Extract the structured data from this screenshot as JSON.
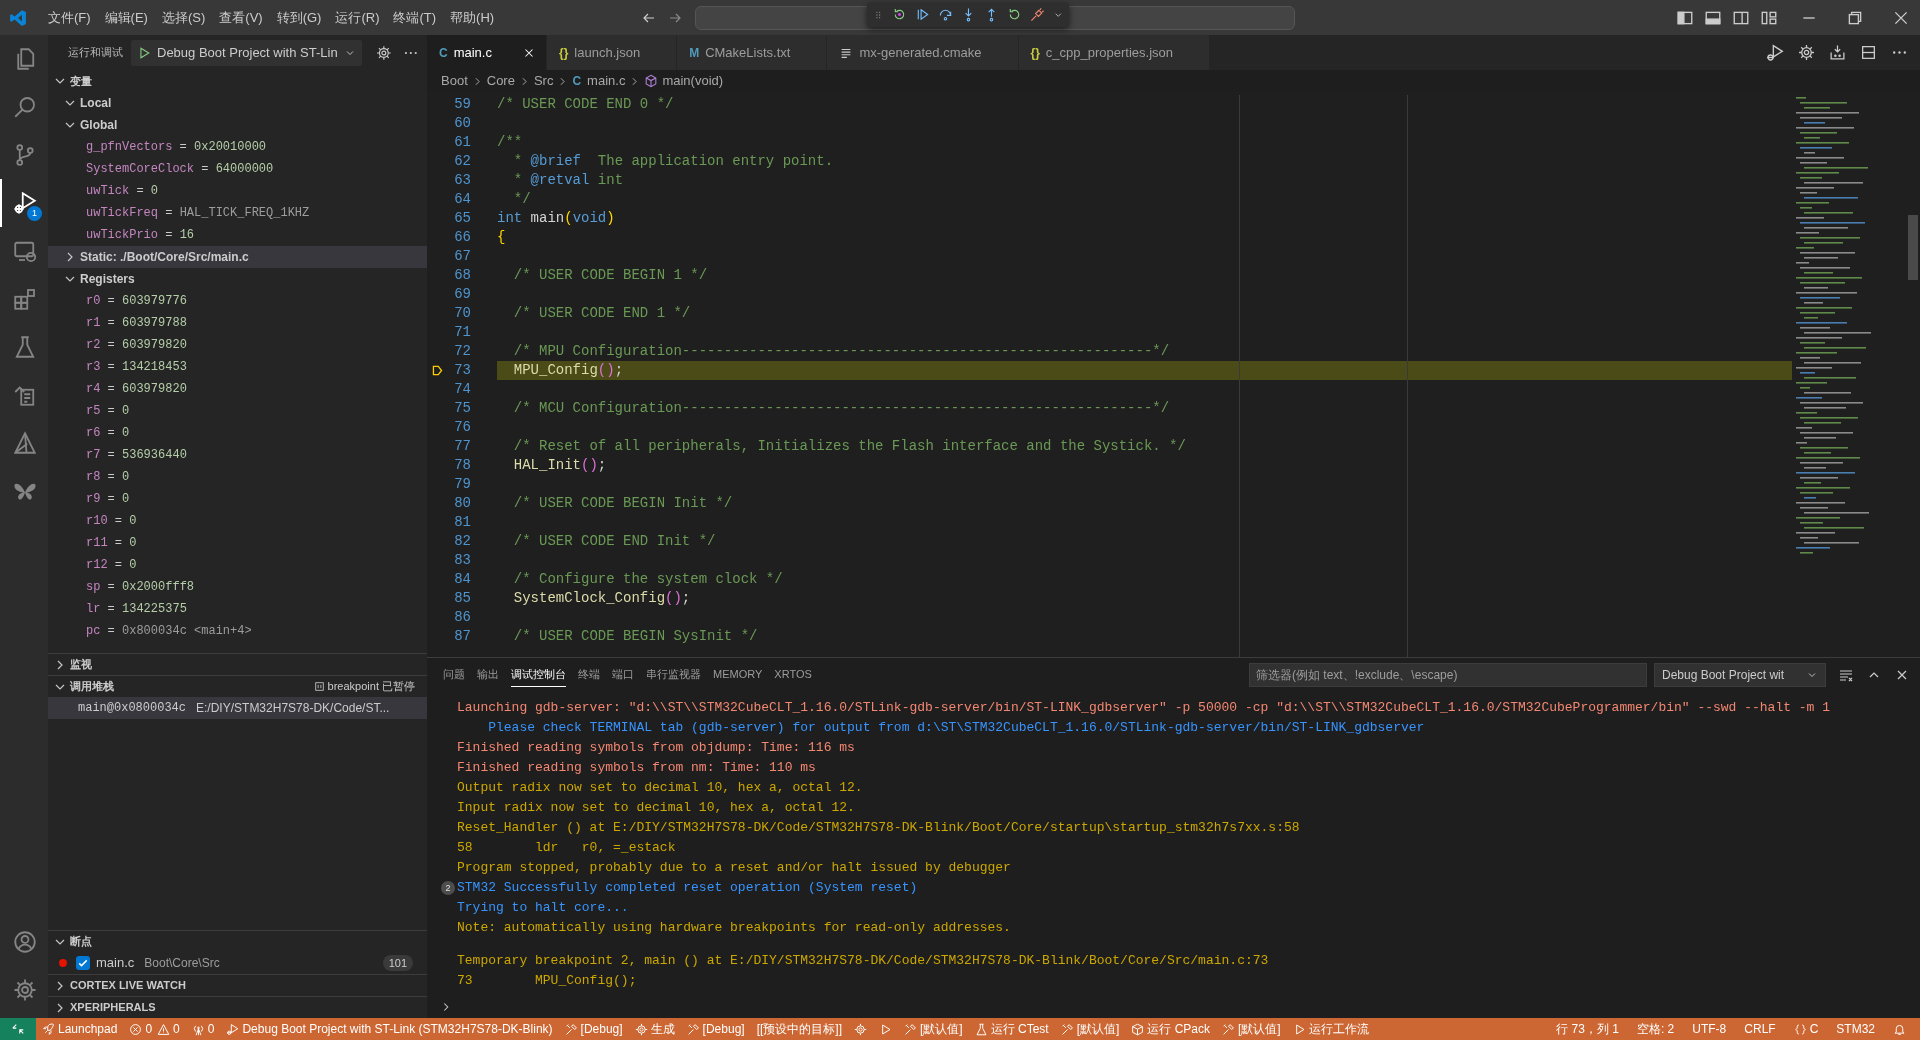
{
  "title_bar": {
    "menu": [
      "文件(F)",
      "编辑(E)",
      "选择(S)",
      "查看(V)",
      "转到(G)",
      "运行(R)",
      "终端(T)",
      "帮助(H)"
    ]
  },
  "debug_toolbar": {
    "buttons": [
      {
        "kind": "restart-frame"
      },
      {
        "kind": "continue"
      },
      {
        "kind": "step-over"
      },
      {
        "kind": "step-into"
      },
      {
        "kind": "step-out"
      },
      {
        "kind": "restart"
      },
      {
        "kind": "disconnect"
      }
    ]
  },
  "activity_bar": {
    "items": [
      {
        "kind": "files",
        "selected": false
      },
      {
        "kind": "search",
        "selected": false
      },
      {
        "kind": "branch",
        "selected": false
      },
      {
        "kind": "debug",
        "selected": true,
        "badge": "1"
      },
      {
        "kind": "remote",
        "selected": false
      },
      {
        "kind": "extensions",
        "selected": false
      },
      {
        "kind": "flask",
        "selected": false
      },
      {
        "kind": "document",
        "selected": false
      },
      {
        "kind": "cmake",
        "selected": false
      },
      {
        "kind": "stm32",
        "selected": false
      }
    ],
    "bottom": [
      {
        "kind": "account",
        "selected": false
      },
      {
        "kind": "gear",
        "selected": false
      }
    ]
  },
  "sidebar": {
    "title": "运行和调试",
    "config": "Debug Boot Project with ST-Lin",
    "sections": [
      {
        "kind": "variables",
        "title": "变量",
        "expanded": true,
        "children": [
          {
            "label": "Local",
            "expanded": true,
            "selected": false
          },
          {
            "label": "Global",
            "expanded": true,
            "selected": false,
            "children": [
              {
                "name": "g_pfnVectors",
                "sign": "=",
                "value": "0x20010000",
                "kind": "number"
              },
              {
                "name": "SystemCoreClock",
                "sign": "=",
                "value": "64000000",
                "kind": "number"
              },
              {
                "name": "uwTick",
                "sign": "=",
                "value": "0",
                "kind": "number"
              },
              {
                "name": "uwTickFreq",
                "sign": "=",
                "value": "HAL_TICK_FREQ_1KHZ",
                "kind": "symbol"
              },
              {
                "name": "uwTickPrio",
                "sign": "=",
                "value": "16",
                "kind": "number"
              }
            ]
          },
          {
            "label": "Static: ./Boot/Core/Src/main.c",
            "expanded": false,
            "selected": true
          },
          {
            "label": "Registers",
            "expanded": true,
            "selected": false,
            "children": [
              {
                "name": "r0",
                "sign": "=",
                "value": "603979776",
                "kind": "number"
              },
              {
                "name": "r1",
                "sign": "=",
                "value": "603979788",
                "kind": "number"
              },
              {
                "name": "r2",
                "sign": "=",
                "value": "603979820",
                "kind": "number"
              },
              {
                "name": "r3",
                "sign": "=",
                "value": "134218453",
                "kind": "number"
              },
              {
                "name": "r4",
                "sign": "=",
                "value": "603979820",
                "kind": "number"
              },
              {
                "name": "r5",
                "sign": "=",
                "value": "0",
                "kind": "number"
              },
              {
                "name": "r6",
                "sign": "=",
                "value": "0",
                "kind": "number"
              },
              {
                "name": "r7",
                "sign": "=",
                "value": "536936440",
                "kind": "number"
              },
              {
                "name": "r8",
                "sign": "=",
                "value": "0",
                "kind": "number"
              },
              {
                "name": "r9",
                "sign": "=",
                "value": "0",
                "kind": "number"
              },
              {
                "name": "r10",
                "sign": "=",
                "value": "0",
                "kind": "number"
              },
              {
                "name": "r11",
                "sign": "=",
                "value": "0",
                "kind": "number"
              },
              {
                "name": "r12",
                "sign": "=",
                "value": "0",
                "kind": "number"
              },
              {
                "name": "sp",
                "sign": "=",
                "value": "0x2000fff8",
                "kind": "number"
              },
              {
                "name": "lr",
                "sign": "=",
                "value": "134225375",
                "kind": "number"
              },
              {
                "name": "pc",
                "sign": "=",
                "value": "0x800034c <main+4>",
                "kind": "symbol"
              }
            ]
          }
        ]
      },
      {
        "kind": "generic",
        "title": "监视",
        "expanded": false
      },
      {
        "kind": "call_stack",
        "title": "调用堆栈",
        "expanded": true,
        "status": "breakpoint 已暂停",
        "frames": [
          {
            "function": "main@0x0800034c",
            "file": "E:/DIY/STM32H7S78-DK/Code/ST...",
            "selected": true
          }
        ]
      },
      {
        "kind": "breakpoints",
        "title": "断点",
        "expanded": true,
        "items": [
          {
            "file": "main.c",
            "path": "Boot\\Core\\Src",
            "line": "101",
            "checked": true
          }
        ]
      },
      {
        "kind": "generic",
        "title": "CORTEX LIVE WATCH",
        "expanded": false
      },
      {
        "kind": "generic",
        "title": "XPERIPHERALS",
        "expanded": false
      }
    ]
  },
  "editor": {
    "tabs": [
      {
        "label": "main.c",
        "kind": "c",
        "icon": "C",
        "selected": true
      },
      {
        "label": "launch.json",
        "kind": "json",
        "icon": "{}",
        "selected": false
      },
      {
        "label": "CMakeLists.txt",
        "kind": "cmake",
        "icon": "M",
        "selected": false
      },
      {
        "label": "mx-generated.cmake",
        "kind": "text",
        "selected": false
      },
      {
        "label": "c_cpp_properties.json",
        "kind": "json",
        "icon": "{}",
        "selected": false
      }
    ],
    "breadcrumb": [
      {
        "text": "Boot"
      },
      {
        "text": "Core"
      },
      {
        "text": "Src"
      },
      {
        "text": "main.c",
        "icon": "C"
      },
      {
        "text": "main(void)",
        "kind": "symbol"
      }
    ],
    "lines": [
      {
        "n": "59",
        "current": false,
        "parts": [
          {
            "t": "/* USER CODE END 0 */",
            "kind": "comment"
          }
        ]
      },
      {
        "n": "60",
        "current": false
      },
      {
        "n": "61",
        "current": false,
        "parts": [
          {
            "t": "/**",
            "kind": "comment"
          }
        ]
      },
      {
        "n": "62",
        "current": false,
        "parts": [
          {
            "t": "  * ",
            "kind": "comment"
          },
          {
            "t": "@brief",
            "kind": "doctag"
          },
          {
            "t": "  The application entry point.",
            "kind": "comment"
          }
        ]
      },
      {
        "n": "63",
        "current": false,
        "parts": [
          {
            "t": "  * ",
            "kind": "comment"
          },
          {
            "t": "@retval",
            "kind": "doctag"
          },
          {
            "t": " int",
            "kind": "comment"
          }
        ]
      },
      {
        "n": "64",
        "current": false,
        "parts": [
          {
            "t": "  */",
            "kind": "comment"
          }
        ]
      },
      {
        "n": "65",
        "current": false,
        "parts": [
          {
            "t": "int",
            "kind": "keyword"
          },
          {
            "t": " main",
            "kind": "plain"
          },
          {
            "t": "(",
            "kind": "bracket1"
          },
          {
            "t": "void",
            "kind": "keyword"
          },
          {
            "t": ")",
            "kind": "bracket1"
          }
        ]
      },
      {
        "n": "66",
        "current": false,
        "parts": [
          {
            "t": "{",
            "kind": "bracket1"
          }
        ]
      },
      {
        "n": "67",
        "current": false
      },
      {
        "n": "68",
        "current": false,
        "parts": [
          {
            "t": "  /* USER CODE BEGIN 1 */",
            "kind": "comment"
          }
        ]
      },
      {
        "n": "69",
        "current": false
      },
      {
        "n": "70",
        "current": false,
        "parts": [
          {
            "t": "  /* USER CODE END 1 */",
            "kind": "comment"
          }
        ]
      },
      {
        "n": "71",
        "current": false
      },
      {
        "n": "72",
        "current": false,
        "parts": [
          {
            "t": "  /* MPU Configuration--------------------------------------------------------*/",
            "kind": "comment"
          }
        ]
      },
      {
        "n": "73",
        "current": true,
        "parts": [
          {
            "t": "  MPU_Config",
            "kind": "function"
          },
          {
            "t": "()",
            "kind": "bracket2"
          },
          {
            "t": ";",
            "kind": "plain"
          }
        ]
      },
      {
        "n": "74",
        "current": false
      },
      {
        "n": "75",
        "current": false,
        "parts": [
          {
            "t": "  /* MCU Configuration--------------------------------------------------------*/",
            "kind": "comment"
          }
        ]
      },
      {
        "n": "76",
        "current": false
      },
      {
        "n": "77",
        "current": false,
        "parts": [
          {
            "t": "  /* Reset of all peripherals, Initializes the Flash interface and the Systick. */",
            "kind": "comment"
          }
        ]
      },
      {
        "n": "78",
        "current": false,
        "parts": [
          {
            "t": "  HAL_Init",
            "kind": "function"
          },
          {
            "t": "()",
            "kind": "bracket2"
          },
          {
            "t": ";",
            "kind": "plain"
          }
        ]
      },
      {
        "n": "79",
        "current": false
      },
      {
        "n": "80",
        "current": false,
        "parts": [
          {
            "t": "  /* USER CODE BEGIN Init */",
            "kind": "comment"
          }
        ]
      },
      {
        "n": "81",
        "current": false
      },
      {
        "n": "82",
        "current": false,
        "parts": [
          {
            "t": "  /* USER CODE END Init */",
            "kind": "comment"
          }
        ]
      },
      {
        "n": "83",
        "current": false
      },
      {
        "n": "84",
        "current": false,
        "parts": [
          {
            "t": "  /* Configure the system clock */",
            "kind": "comment"
          }
        ]
      },
      {
        "n": "85",
        "current": false,
        "parts": [
          {
            "t": "  SystemClock_Config",
            "kind": "function"
          },
          {
            "t": "()",
            "kind": "bracket2"
          },
          {
            "t": ";",
            "kind": "plain"
          }
        ]
      },
      {
        "n": "86",
        "current": false
      },
      {
        "n": "87",
        "current": false,
        "parts": [
          {
            "t": "  /* USER CODE BEGIN SysInit */",
            "kind": "comment"
          }
        ]
      }
    ]
  },
  "panel": {
    "tabs": [
      {
        "label": "问题",
        "selected": false
      },
      {
        "label": "输出",
        "selected": false
      },
      {
        "label": "调试控制台",
        "selected": true
      },
      {
        "label": "终端",
        "selected": false
      },
      {
        "label": "端口",
        "selected": false
      },
      {
        "label": "串行监视器",
        "selected": false
      },
      {
        "label": "MEMORY",
        "selected": false
      },
      {
        "label": "XRTOS",
        "selected": false
      }
    ],
    "filter": {
      "placeholder": "筛选器(例如 text、!exclude、\\escape)"
    },
    "session": "Debug Boot Project wit",
    "lines": [
      {
        "kind": "stderr",
        "text": "Launching gdb-server: \"d:\\\\ST\\\\STM32CubeCLT_1.16.0/STLink-gdb-server/bin/ST-LINK_gdbserver\" -p 50000 -cp \"d:\\\\ST\\\\STM32CubeCLT_1.16.0/STM32CubeProgrammer/bin\" --swd --halt -m 1"
      },
      {
        "kind": "console",
        "text": "    Please check TERMINAL tab (gdb-server) for output from d:\\ST\\STM32CubeCLT_1.16.0/STLink-gdb-server/bin/ST-LINK_gdbserver"
      },
      {
        "kind": "stderr",
        "text": "Finished reading symbols from objdump: Time: 116 ms"
      },
      {
        "kind": "stderr",
        "text": "Finished reading symbols from nm: Time: 110 ms"
      },
      {
        "kind": "stdout",
        "text": "Output radix now set to decimal 10, hex a, octal 12."
      },
      {
        "kind": "stdout",
        "text": "Input radix now set to decimal 10, hex a, octal 12."
      },
      {
        "kind": "stdout",
        "text": "Reset_Handler () at E:/DIY/STM32H7S78-DK/Code/STM32H7S78-DK-Blink/Boot/Core/startup\\startup_stm32h7s7xx.s:58"
      },
      {
        "kind": "stdout",
        "text": "58        ldr   r0, =_estack"
      },
      {
        "kind": "stdout",
        "text": "Program stopped, probably due to a reset and/or halt issued by debugger"
      },
      {
        "kind": "console",
        "count": "2",
        "text": "STM32 Successfully completed reset operation (System reset)"
      },
      {
        "kind": "console",
        "text": "Trying to halt core..."
      },
      {
        "kind": "stdout",
        "text": "Note: automatically using hardware breakpoints for read-only addresses."
      },
      {
        "kind": "stdout",
        "blank_before": true,
        "text": "Temporary breakpoint 2, main () at E:/DIY/STM32H7S78-DK/Code/STM32H7S78-DK-Blink/Boot/Core/Src/main.c:73"
      },
      {
        "kind": "stdout",
        "text": "73        MPU_Config();"
      }
    ]
  },
  "status_bar": {
    "left": [
      {
        "kind": "rocket",
        "text": "Launchpad"
      },
      {
        "kind": "problems",
        "errors": "0",
        "warnings": "0"
      },
      {
        "kind": "antenna",
        "text": "0"
      },
      {
        "kind": "debug",
        "text": "Debug Boot Project with ST-Link (STM32H7S78-DK-Blink)"
      },
      {
        "kind": "tool",
        "text": "[Debug]"
      },
      {
        "kind": "gear",
        "text": "生成"
      },
      {
        "kind": "tool",
        "text": "[Debug]"
      },
      {
        "kind": "plain",
        "text": "[[预设中的目标]]"
      },
      {
        "kind": "gear"
      },
      {
        "kind": "play"
      },
      {
        "kind": "tool",
        "text": "[默认值]"
      },
      {
        "kind": "flask",
        "text": "运行 CTest"
      },
      {
        "kind": "tool",
        "text": "[默认值]"
      },
      {
        "kind": "box",
        "text": "运行 CPack"
      },
      {
        "kind": "tool",
        "text": "[默认值]"
      },
      {
        "kind": "play",
        "text": "运行工作流"
      }
    ],
    "right": [
      {
        "kind": "plain",
        "text": "行 73，列 1"
      },
      {
        "kind": "plain",
        "text": "空格: 2"
      },
      {
        "kind": "plain",
        "text": "UTF-8"
      },
      {
        "kind": "plain",
        "text": "CRLF"
      },
      {
        "kind": "braces",
        "text": "C"
      },
      {
        "kind": "plain",
        "text": "STM32"
      },
      {
        "kind": "bell"
      }
    ]
  }
}
